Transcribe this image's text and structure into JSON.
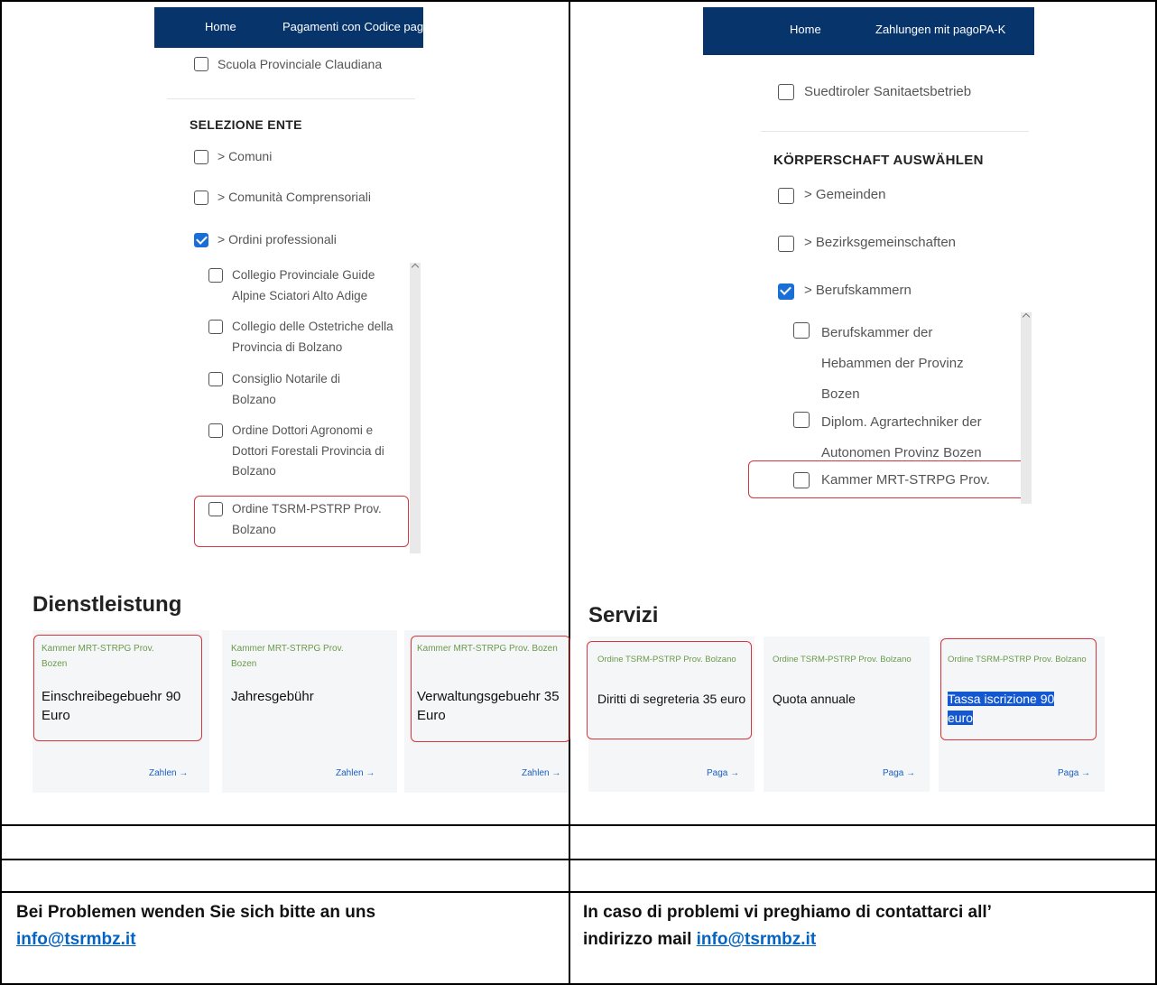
{
  "left_shot": {
    "nav": [
      "Home",
      "Pagamenti con Codice pag"
    ],
    "first_item": "Scuola Provinciale Claudiana",
    "section": "SELEZIONE ENTE",
    "groups": [
      "> Comuni",
      "> Comunità Comprensoriali",
      "> Ordini professionali"
    ],
    "items": [
      "Collegio Provinciale Guide Alpine Sciatori Alto Adige",
      "Collegio delle Ostetriche della Provincia di Bolzano",
      "Consiglio Notarile di Bolzano",
      "Ordine Dottori Agronomi e Dottori Forestali Provincia di Bolzano",
      "Ordine TSRM-PSTRP Prov. Bolzano"
    ]
  },
  "right_shot": {
    "nav": [
      "Home",
      "Zahlungen mit pagoPA-K"
    ],
    "first_item": "Suedtiroler Sanitaetsbetrieb",
    "section": "KÖRPERSCHAFT AUSWÄHLEN",
    "groups": [
      "> Gemeinden",
      "> Bezirksgemeinschaften",
      "> Berufskammern"
    ],
    "items": [
      "Berufskammer der Hebammen der Provinz Bozen",
      "Diplom. Agrartechniker der Autonomen Provinz Bozen",
      "Kammer MRT-STRPG Prov."
    ]
  },
  "services_de": {
    "heading": "Dienstleistung",
    "cards": [
      {
        "org": "Kammer MRT-STRPG Prov. Bozen",
        "title": "Einschreibegebuehr 90 Euro",
        "action": "Zahlen →"
      },
      {
        "org": "Kammer MRT-STRPG Prov. Bozen",
        "title": "Jahresgebühr",
        "action": "Zahlen →"
      },
      {
        "org": "Kammer MRT-STRPG Prov. Bozen",
        "title": "Verwaltungsgebuehr 35 Euro",
        "action": "Zahlen →"
      }
    ]
  },
  "services_it": {
    "heading": "Servizi",
    "cards": [
      {
        "org": "Ordine TSRM-PSTRP Prov. Bolzano",
        "title": "Diritti di segreteria 35 euro",
        "action": "Paga →"
      },
      {
        "org": "Ordine TSRM-PSTRP Prov. Bolzano",
        "title": "Quota annuale",
        "action": "Paga →"
      },
      {
        "org": "Ordine TSRM-PSTRP Prov. Bolzano",
        "title_a": "Tassa iscrizione 90",
        "title_b": "euro",
        "action": "Paga →"
      }
    ]
  },
  "footer": {
    "de_text": "Bei Problemen wenden Sie sich bitte an uns",
    "it_text_1": "In caso di problemi vi preghiamo di contattarci all’",
    "it_text_2": "indirizzo mail",
    "email": "info@tsrmbz.it"
  },
  "colors": {
    "nav": "#06346b",
    "highlight": "#d7353b",
    "checked": "#1a6fd6",
    "org_text": "#6a9a4a",
    "link": "#0563c1"
  }
}
